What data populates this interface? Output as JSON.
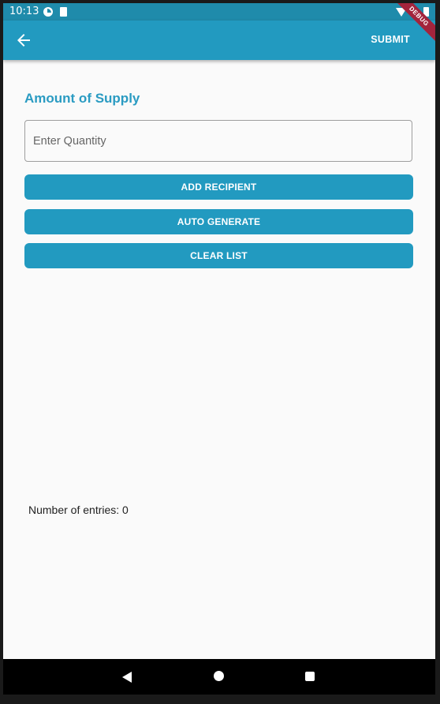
{
  "status_bar": {
    "time": "10:13"
  },
  "debug_banner": "DEBUG",
  "app_bar": {
    "back_icon": "arrow-back-icon",
    "submit_label": "SUBMIT"
  },
  "form": {
    "title": "Amount of Supply",
    "quantity_placeholder": "Enter Quantity",
    "quantity_value": ""
  },
  "buttons": {
    "add_recipient": "ADD RECIPIENT",
    "auto_generate": "AUTO GENERATE",
    "clear_list": "CLEAR LIST"
  },
  "entries": {
    "label": "Number of entries: 0"
  },
  "colors": {
    "primary": "#229ac0",
    "status_bar": "#1f8bab",
    "title": "#2a9bc2",
    "background": "#fafafa"
  }
}
